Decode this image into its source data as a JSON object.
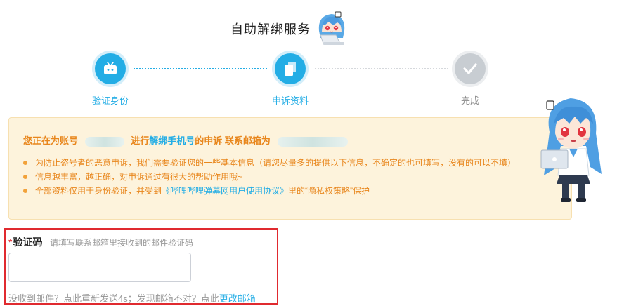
{
  "page": {
    "title": "自助解绑服务"
  },
  "steps": [
    {
      "label": "验证身份",
      "state": "done",
      "icon": "tv-icon"
    },
    {
      "label": "申诉资料",
      "state": "active",
      "icon": "document-icon"
    },
    {
      "label": "完成",
      "state": "todo",
      "icon": "check-icon"
    }
  ],
  "notice": {
    "head_part1": "您正在为账号",
    "head_part2": "进行",
    "head_highlight": "解绑手机号",
    "head_part3": "的申诉 联系邮箱为",
    "items": [
      "为防止盗号者的恶意申诉，我们需要验证您的一些基本信息（请您尽量多的提供以下信息，不确定的也可填写，没有的可以不填）",
      "信息越丰富，越正确，对申诉通过有很大的帮助作用哦~"
    ],
    "item3_before": "全部资料仅用于身份验证，并受到",
    "item3_link": "《哔哩哔哩弹幕网用户使用协议》",
    "item3_after": "里的“隐私权策略”保护"
  },
  "verify": {
    "required_mark": "*",
    "label": "验证码",
    "hint": "请填写联系邮箱里接收到的邮件验证码",
    "input_value": "",
    "bottom_text": "没收到邮件？点此重新发送4s；发现邮箱不对？点此",
    "change_email": "更改邮箱"
  },
  "colors": {
    "accent": "#23ade5",
    "warning": "#e8861c",
    "notice_bg": "#fdf3dc",
    "highlight_border": "#e02a2f"
  }
}
